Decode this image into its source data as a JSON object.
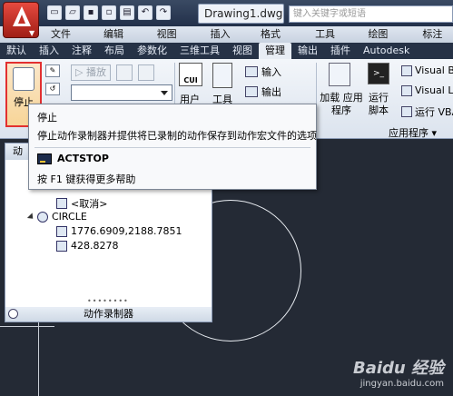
{
  "title_bar": {
    "document_tab": "Drawing1.dwg",
    "search_placeholder": "键入关键字或短语"
  },
  "menubar": {
    "items": [
      "文件(F)",
      "编辑(E)",
      "视图(V)",
      "插入(I)",
      "格式(O)",
      "工具(T)",
      "绘图(D)",
      "标注(N)"
    ]
  },
  "ribbon_tabs": {
    "items": [
      "默认",
      "插入",
      "注释",
      "布局",
      "参数化",
      "三维工具",
      "视图",
      "管理",
      "输出",
      "插件",
      "Autodesk"
    ],
    "active": "管理"
  },
  "ribbon": {
    "stop_label": "停止",
    "play_label": "▷ 播放",
    "cui_icon_text": "CUI",
    "user_interface_label": "用户",
    "tool_label": "工具",
    "import_label": "输入",
    "export_label": "输出",
    "load_app_label": "加载 应用程序",
    "run_script_label": "运行 脚本",
    "visual_basic_1": "Visual B",
    "visual_basic_2": "Visual L",
    "run_vba": "运行 VBA",
    "panel_title": "应用程序 ▾"
  },
  "tooltip": {
    "title": "停止",
    "description": "停止动作录制器并提供将已录制的动作保存到动作宏文件的选项",
    "command": "ACTSTOP",
    "help": "按 F1 键获得更多帮助"
  },
  "recorder_palette": {
    "header": "动",
    "rows": [
      {
        "label": "<取消>"
      },
      {
        "label": "CIRCLE"
      },
      {
        "label": "1776.6909,2188.7851"
      },
      {
        "label": "428.8278"
      }
    ],
    "footer": "动作录制器"
  },
  "watermark": {
    "logo": "Baidu 经验",
    "sub": "jingyan.baidu.com"
  }
}
